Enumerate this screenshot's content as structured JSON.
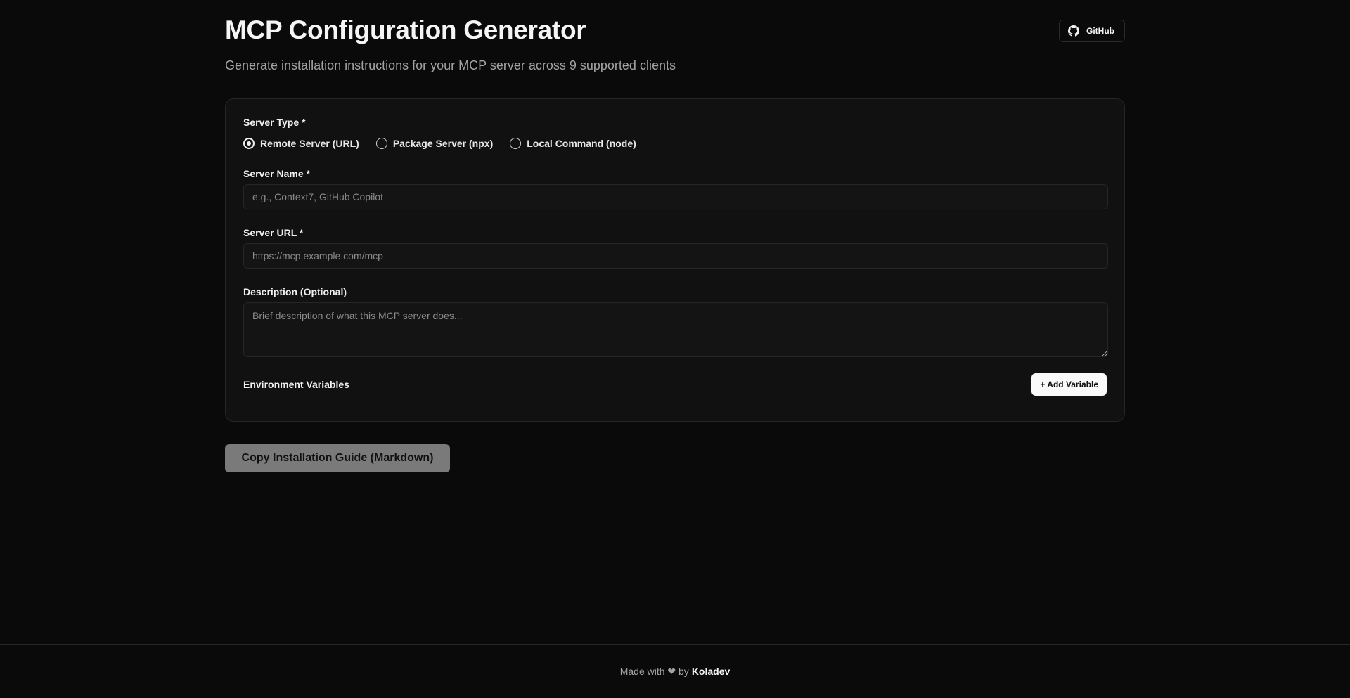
{
  "header": {
    "title": "MCP Configuration Generator",
    "subtitle": "Generate installation instructions for your MCP server across 9 supported clients",
    "github_label": "GitHub"
  },
  "form": {
    "server_type": {
      "label": "Server Type *",
      "options": [
        {
          "label": "Remote Server (URL)",
          "checked": true
        },
        {
          "label": "Package Server (npx)",
          "checked": false
        },
        {
          "label": "Local Command (node)",
          "checked": false
        }
      ]
    },
    "server_name": {
      "label": "Server Name *",
      "value": "",
      "placeholder": "e.g., Context7, GitHub Copilot"
    },
    "server_url": {
      "label": "Server URL *",
      "value": "",
      "placeholder": "https://mcp.example.com/mcp"
    },
    "description": {
      "label": "Description (Optional)",
      "value": "",
      "placeholder": "Brief description of what this MCP server does..."
    },
    "env_vars": {
      "label": "Environment Variables",
      "add_label": "+ Add Variable"
    }
  },
  "actions": {
    "copy_label": "Copy Installation Guide (Markdown)"
  },
  "footer": {
    "prefix": "Made with ❤ by",
    "brand": "Koladev"
  },
  "icons": {
    "github": "github-icon"
  },
  "colors": {
    "background": "#0a0a0a",
    "card": "#111111",
    "border": "#262626",
    "text": "#ededed",
    "muted": "#a3a3a3",
    "disabled_button": "#7a7a7a"
  }
}
